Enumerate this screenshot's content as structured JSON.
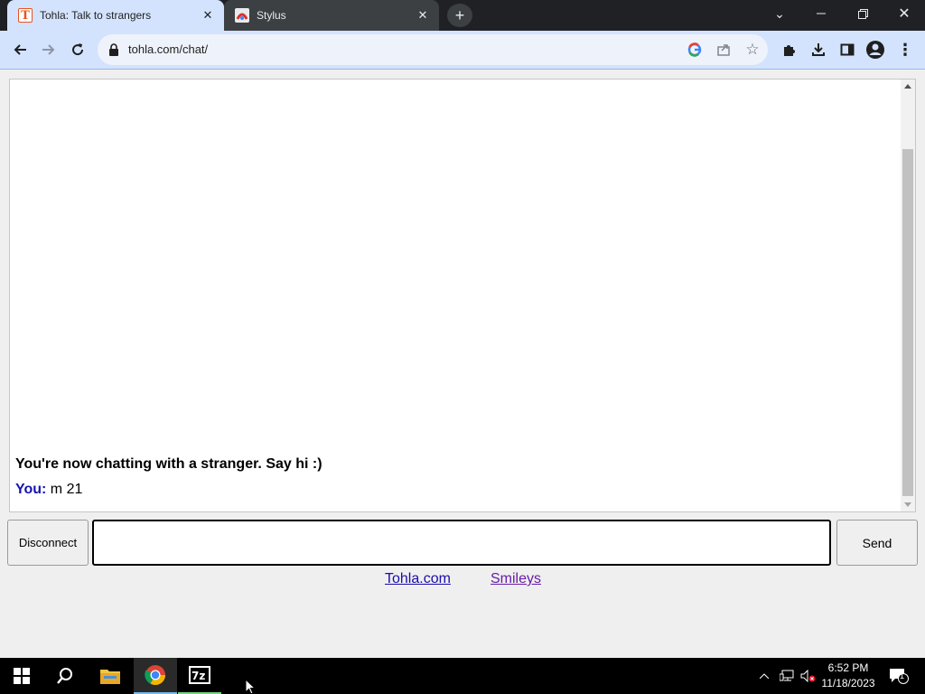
{
  "browser": {
    "tabs": [
      {
        "title": "Tohla: Talk to strangers",
        "active": true
      },
      {
        "title": "Stylus",
        "active": false
      }
    ],
    "url": "tohla.com/chat/"
  },
  "chat": {
    "system_message": "You're now chatting with a stranger. Say hi :)",
    "messages": [
      {
        "sender": "You:",
        "text": " m 21"
      }
    ]
  },
  "controls": {
    "disconnect_label": "Disconnect",
    "send_label": "Send",
    "input_value": ""
  },
  "footer": {
    "links": [
      "Tohla.com",
      "Smileys"
    ]
  },
  "taskbar": {
    "time": "6:52 PM",
    "date": "11/18/2023",
    "notification_count": "1"
  },
  "colors": {
    "accent": "#d3e3fd",
    "you_label": "#1414b4",
    "link": "#1a0dab",
    "visited_link": "#681da8"
  }
}
